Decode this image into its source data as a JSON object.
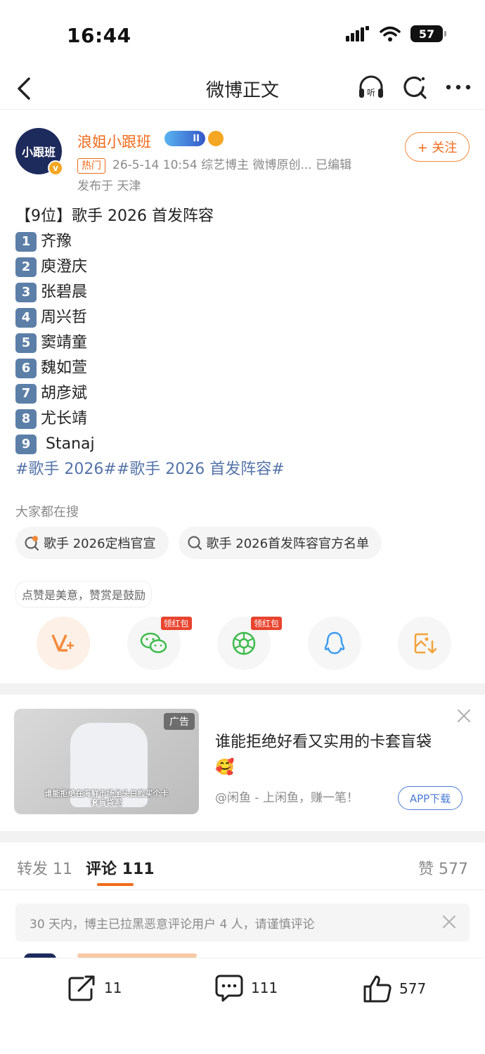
{
  "status_bar": {
    "time": "16:44",
    "battery": "57"
  },
  "nav": {
    "title": "微博正文"
  },
  "author": {
    "avatar_text": "小跟班",
    "name": "浪姐小跟班",
    "level": "II",
    "hot_tag": "热门",
    "meta": "26-5-14 10:54  综艺博主 微博原创...  已编辑",
    "posted_from": "发布于 天津",
    "follow_label": "+ 关注"
  },
  "post": {
    "headline": "【9位】歌手 2026 首发阵容",
    "lineup": [
      {
        "num": "1",
        "name": "齐豫"
      },
      {
        "num": "2",
        "name": "庾澄庆"
      },
      {
        "num": "3",
        "name": "张碧晨"
      },
      {
        "num": "4",
        "name": "周兴哲"
      },
      {
        "num": "5",
        "name": "窦靖童"
      },
      {
        "num": "6",
        "name": "魏如萱"
      },
      {
        "num": "7",
        "name": "胡彦斌"
      },
      {
        "num": "8",
        "name": "尤长靖"
      },
      {
        "num": "9",
        "name": " Stanaj"
      }
    ],
    "hashtags": "#歌手 2026##歌手 2026 首发阵容#"
  },
  "search": {
    "label": "大家都在搜",
    "chips": [
      "歌手 2026定档官宣",
      "歌手 2026首发阵容官方名单"
    ]
  },
  "reward": {
    "tip": "点赞是美意，赞赏是鼓励",
    "hongbao_label": "领红包"
  },
  "ad": {
    "tag": "广告",
    "image_caption": "谁能拒绝在海鲜市场坐头白脸买个卡套盲袋呢",
    "title": "谁能拒绝好看又实用的卡套盲袋",
    "emoji": "🥰",
    "source": "@闲鱼 - 上闲鱼，赚一笔！",
    "button": "APP下载"
  },
  "tabs": {
    "repost": "转发 11",
    "comments": "评论 111",
    "likes": "赞 577"
  },
  "notice": "30 天内，博主已拉黑恶意评论用户 4 人，请谨慎评论",
  "bottom_bar": {
    "repost": "11",
    "comments": "111",
    "likes": "577"
  },
  "colors": {
    "accent": "#f06b1a",
    "link": "#5574a8",
    "number_key": "#5c7fa8"
  }
}
